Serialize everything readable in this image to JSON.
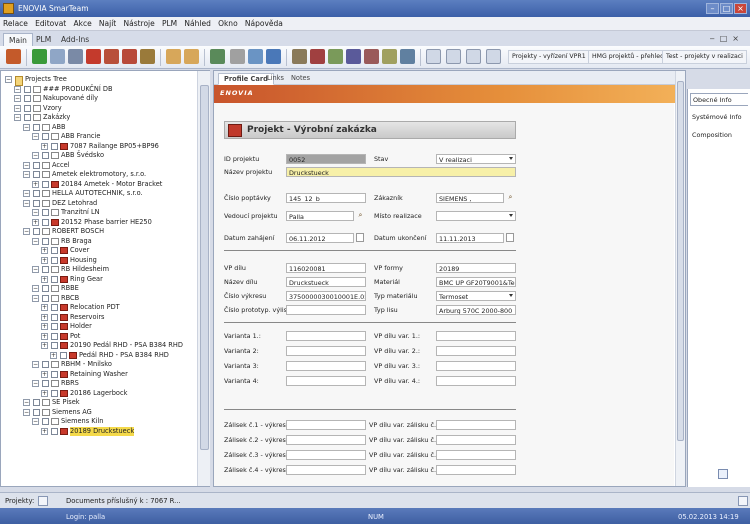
{
  "window": {
    "title": "ENOVIA SmarTeam"
  },
  "menu": [
    "Relace",
    "Editovat",
    "Akce",
    "Najít",
    "Nástroje",
    "PLM",
    "Náhled",
    "Okno",
    "Nápověda"
  ],
  "ribbon_tabs": [
    "Main",
    "PLM",
    "Add-Ins"
  ],
  "toolbar_buttons": [
    "Projekty - vyřízení VPR1",
    "HMG projektů - přehled",
    "Test - projekty v realizaci"
  ],
  "tree": {
    "root": "Projects Tree",
    "nodes": [
      {
        "label": "### PRODUKČNÍ DB",
        "level": 1,
        "icon": "folder"
      },
      {
        "label": "Nakupované díly",
        "level": 1,
        "icon": "folder"
      },
      {
        "label": "Vzory",
        "level": 1,
        "icon": "folder"
      },
      {
        "label": "Zakázky",
        "level": 1,
        "icon": "folder"
      },
      {
        "label": "ABB",
        "level": 2,
        "icon": "folder"
      },
      {
        "label": "ABB Francie",
        "level": 3,
        "icon": "folder"
      },
      {
        "label": "7087 Railange BP05+BP96",
        "level": 4,
        "icon": "red"
      },
      {
        "label": "ABB Švédsko",
        "level": 3,
        "icon": "folder"
      },
      {
        "label": "Accel",
        "level": 2,
        "icon": "folder"
      },
      {
        "label": "Ametek elektromotory, s.r.o.",
        "level": 2,
        "icon": "folder"
      },
      {
        "label": "20184 Ametek - Motor Bracket",
        "level": 3,
        "icon": "red"
      },
      {
        "label": "HELLA AUTOTECHNIK, s.r.o.",
        "level": 2,
        "icon": "folder"
      },
      {
        "label": "DEZ Letohrad",
        "level": 2,
        "icon": "folder"
      },
      {
        "label": "Tranzitní LN",
        "level": 3,
        "icon": "folder"
      },
      {
        "label": "20152 Phase barrier HE250",
        "level": 3,
        "icon": "red"
      },
      {
        "label": "ROBERT BOSCH",
        "level": 2,
        "icon": "folder"
      },
      {
        "label": "RB Braga",
        "level": 3,
        "icon": "folder"
      },
      {
        "label": "Cover",
        "level": 4,
        "icon": "red"
      },
      {
        "label": "Housing",
        "level": 4,
        "icon": "red"
      },
      {
        "label": "RB Hildesheim",
        "level": 3,
        "icon": "folder"
      },
      {
        "label": "Ring Gear",
        "level": 4,
        "icon": "red"
      },
      {
        "label": "RBBE",
        "level": 3,
        "icon": "folder"
      },
      {
        "label": "RBCB",
        "level": 3,
        "icon": "folder"
      },
      {
        "label": "Relocation PDT",
        "level": 4,
        "icon": "red"
      },
      {
        "label": "Reservoirs",
        "level": 4,
        "icon": "red"
      },
      {
        "label": "Holder",
        "level": 4,
        "icon": "red"
      },
      {
        "label": "Pot",
        "level": 4,
        "icon": "red"
      },
      {
        "label": "20190 Pedál RHD - PSA B384 RHD",
        "level": 4,
        "icon": "red"
      },
      {
        "label": "Pedál RHD - PSA B384 RHD",
        "level": 5,
        "icon": "red"
      },
      {
        "label": "RBHM - Mnilsko",
        "level": 3,
        "icon": "folder"
      },
      {
        "label": "Retaining Washer",
        "level": 4,
        "icon": "red"
      },
      {
        "label": "RBRS",
        "level": 3,
        "icon": "folder"
      },
      {
        "label": "20186 Lagerbock",
        "level": 4,
        "icon": "red"
      },
      {
        "label": "SE Písek",
        "level": 2,
        "icon": "folder"
      },
      {
        "label": "Siemens AG",
        "level": 2,
        "icon": "folder"
      },
      {
        "label": "Siemens Kiln",
        "level": 3,
        "icon": "folder"
      },
      {
        "label": "20189 Druckstueck",
        "level": 4,
        "icon": "red",
        "selected": true
      }
    ]
  },
  "form_tabs": [
    "Profile Card",
    "Links",
    "Notes"
  ],
  "banner": {
    "logo": "ENOVIA"
  },
  "form": {
    "title": "Projekt - Výrobní zakázka",
    "id_projektu": {
      "label": "ID projektu",
      "value": "0052"
    },
    "nazev_projektu": {
      "label": "Název projektu",
      "value": "Druckstueck"
    },
    "stav": {
      "label": "Stav",
      "value": "V realizaci"
    },
    "cislo_poptavky": {
      "label": "Číslo poptávky",
      "value": "145_12_b"
    },
    "zakaznik": {
      "label": "Zákazník",
      "value": "SIEMENS ,"
    },
    "vedouci": {
      "label": "Vedoucí projektu",
      "value": "Palla"
    },
    "misto": {
      "label": "Místo realizace",
      "value": ""
    },
    "zahajeni": {
      "label": "Datum zahájení",
      "value": "06.11.2012"
    },
    "ukonceni": {
      "label": "Datum ukončení",
      "value": "11.11.2013"
    },
    "vp_dilu": {
      "label": "VP dílu",
      "value": "116020081"
    },
    "vp_formy": {
      "label": "VP formy",
      "value": "20189"
    },
    "nazev_dilu": {
      "label": "Název dílu",
      "value": "Druckstueck"
    },
    "material": {
      "label": "Materiál",
      "value": "BMC UP GF20T9001&Ter"
    },
    "cislo_vykresu": {
      "label": "Číslo výkresu",
      "value": "3750000030010001E.05"
    },
    "typ_materialu": {
      "label": "Typ materiálu",
      "value": "Termoset"
    },
    "cislo_prototypu": {
      "label": "Číslo prototyp. výlis.",
      "value": ""
    },
    "typ_lisu": {
      "label": "Typ lisu",
      "value": "Arburg 570C 2000-800"
    },
    "varianty": [
      "Varianta 1.:",
      "Varianta 2:",
      "Varianta 3:",
      "Varianta 4:"
    ],
    "vp_variant": [
      "VP dílu var. 1.:",
      "VP dílu var. 2.:",
      "VP dílu var. 3.:",
      "VP dílu var. 4.:"
    ],
    "zalisky": [
      "Zálisek č.1 - výkres",
      "Zálisek č.2 - výkres",
      "Zálisek č.3 - výkres",
      "Zálisek č.4 - výkres"
    ],
    "vp_zalisku": [
      "VP dílu var. zálisku č.1",
      "VP dílu var. zálisku č.2",
      "VP dílu var. zálisku č.3",
      "VP dílu var. zálisku č.4"
    ]
  },
  "side_panel": [
    "Obecné Info",
    "Systémové Info",
    "Composition"
  ],
  "bottom": {
    "projekty_label": "Projekty:",
    "documents_text": "Documents příslušný k : 7067 R..."
  },
  "status": {
    "login": "Login: palla",
    "num": "NUM",
    "datetime": "05.02.2013 14:19"
  }
}
